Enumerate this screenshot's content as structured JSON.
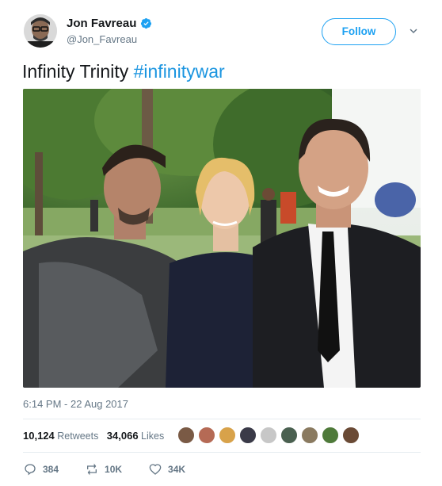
{
  "author": {
    "name": "Jon Favreau",
    "handle": "@Jon_Favreau",
    "verified_icon": "verified-badge-icon",
    "follow_label": "Follow"
  },
  "tweet": {
    "text": "Infinity Trinity ",
    "hashtag": "#infinitywar",
    "timestamp": "6:14 PM - 22 Aug 2017"
  },
  "stats": {
    "retweets_count": "10,124",
    "retweets_label": "Retweets",
    "likes_count": "34,066",
    "likes_label": "Likes"
  },
  "actions": {
    "reply_count": "384",
    "retweet_count": "10K",
    "like_count": "34K"
  },
  "colors": {
    "accent": "#1da1f2",
    "hashtag": "#1b95e0",
    "muted": "#657786"
  }
}
